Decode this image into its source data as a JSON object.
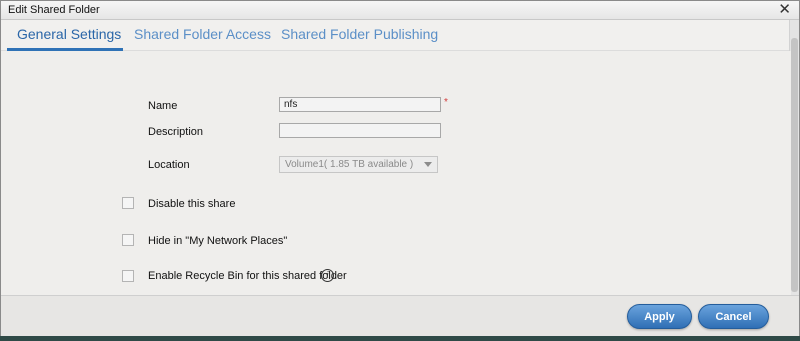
{
  "window": {
    "title": "Edit Shared Folder"
  },
  "tabs": [
    {
      "label": "General Settings",
      "active": true
    },
    {
      "label": "Shared Folder Access",
      "active": false
    },
    {
      "label": "Shared Folder Publishing",
      "active": false
    }
  ],
  "form": {
    "name": {
      "label": "Name",
      "value": "nfs",
      "required_mark": "*"
    },
    "description": {
      "label": "Description",
      "value": ""
    },
    "location": {
      "label": "Location",
      "selected": "Volume1( 1.85 TB available )"
    }
  },
  "options": [
    {
      "label": "Disable this share",
      "checked": false
    },
    {
      "label": "Hide in \"My Network Places\"",
      "checked": false
    },
    {
      "label": "Enable Recycle Bin for this shared folder",
      "checked": false
    }
  ],
  "info_glyph": "i",
  "footer": {
    "apply_label": "Apply",
    "cancel_label": "Cancel"
  },
  "colors": {
    "accent": "#2f72b6",
    "button": "#3d7fc2",
    "required": "#d23a3a"
  }
}
